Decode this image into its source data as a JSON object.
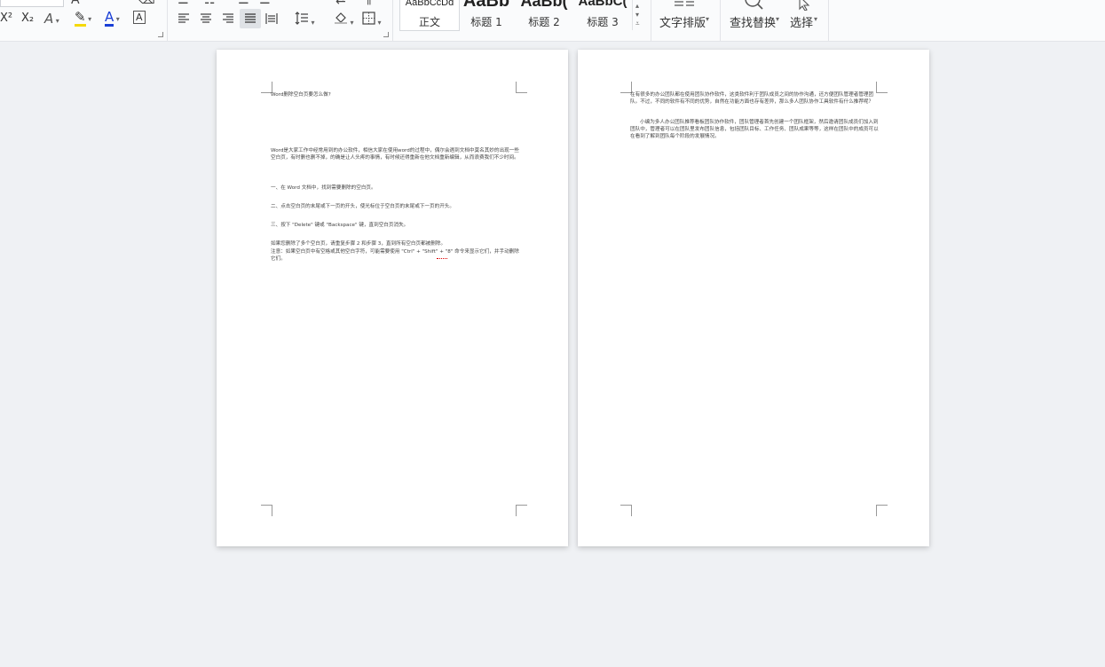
{
  "ribbon": {
    "font_group": {
      "superscript": "X²",
      "subscript": "X₂",
      "text_effect": "A",
      "highlight": "A",
      "font_color": "A",
      "char_border": "A",
      "colors": {
        "highlight": "#f5d90a",
        "font": "#1a3fd6"
      }
    },
    "styles": [
      {
        "sample": "AaBbCcDd",
        "name": "正文"
      },
      {
        "sample": "AaBb",
        "name": "标题 1"
      },
      {
        "sample": "AaBb(",
        "name": "标题 2"
      },
      {
        "sample": "AaBbC(",
        "name": "标题 3"
      }
    ],
    "text_layout_label": "文字排版",
    "find_replace_label": "查找替换",
    "select_label": "选择"
  },
  "page1": {
    "title": "Word删除空白页要怎么做?",
    "intro": "Word是大家工作中经常用到的办公软件，相信大家在使用word的过程中，偶尔会遇到文档中莫名其妙的出现一些空白页，有时删也删不掉，的确是让人头疼的事情，有时候还得重新在他文档重新编辑，从而浪费我们不少时间。",
    "step1": "一、在 Word 文档中，找到需要删除的空白页。",
    "step2": "二、点击空白页的末尾或下一页的开头，使光标位于空白页的末尾或下一页的开头。",
    "step3": "三、按下 \"Delete\" 键或 \"Backspace\" 键，直到空白页消失。",
    "note1": "如果您删除了多个空白页，请重复步骤 2 和步骤 3，直到所有空白页都被删除。",
    "note2": "注意：如果空白页中有空格或其他空白字符，可能需要使用 \"Ctrl\" + \"Shift\" + \"8\" 命令来显示它们，并手动删除它们。"
  },
  "page2": {
    "para1": "在有很多的办公团队都在使用团队协作软件，这类软件利于团队成员之间的协作沟通，还方便团队管理者管理团队。不过，不同的软件有不同的优势，自然在功能方面也存有差异，那么多人团队协作工具软件有什么推荐呢？",
    "para2": "小编为多人办公团队推荐看板团队协作软件，团队管理者首先创建一个团队框架，然后邀请团队成员们加入到团队中，管理者可以在团队里发布团队信息，包括团队目标、工作任务、团队成果等等，这样在团队中的成员可以在看到了解到团队每个阶段的发展情况。"
  }
}
